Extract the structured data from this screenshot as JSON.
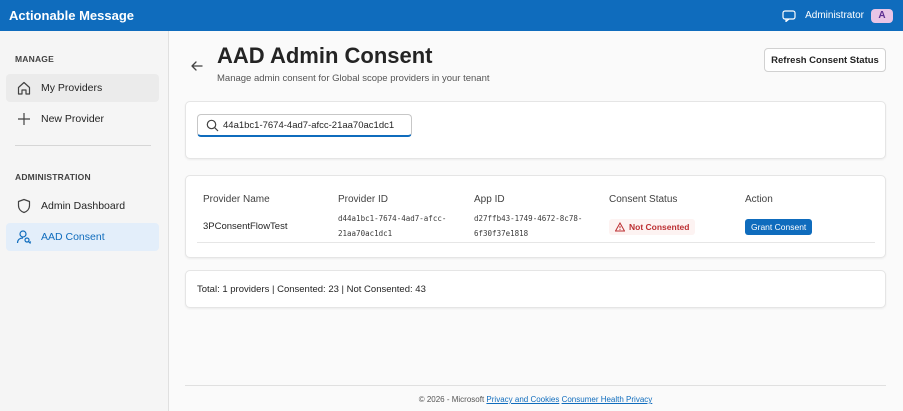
{
  "app": {
    "title": "Actionable Message"
  },
  "user": {
    "name": "Administrator",
    "initial": "A"
  },
  "sidebar": {
    "manage_header": "MANAGE",
    "admin_header": "ADMINISTRATION",
    "items": [
      {
        "label": "My Providers",
        "icon": "home-icon"
      },
      {
        "label": "New Provider",
        "icon": "plus-icon"
      },
      {
        "label": "Admin Dashboard",
        "icon": "shield-icon"
      },
      {
        "label": "AAD Consent",
        "icon": "person-key-icon"
      }
    ]
  },
  "page": {
    "title": "AAD Admin Consent",
    "subtitle": "Manage admin consent for Global scope providers in your tenant",
    "refresh_label": "Refresh Consent Status"
  },
  "search": {
    "value": "44a1bc1-7674-4ad7-afcc-21aa70ac1dc1"
  },
  "table": {
    "headers": [
      "Provider Name",
      "Provider ID",
      "App ID",
      "Consent Status",
      "Action"
    ],
    "rows": [
      {
        "provider_name": "3PConsentFlowTest",
        "provider_id_line1": "d44a1bc1-7674-4ad7-afcc-",
        "provider_id_line2": "21aa70ac1dc1",
        "app_id_line1": "d27ffb43-1749-4672-8c78-",
        "app_id_line2": "6f30f37e1818",
        "status": "Not Consented",
        "action": "Grant Consent"
      }
    ]
  },
  "summary": {
    "text": "Total: 1 providers | Consented: 23 | Not Consented: 43"
  },
  "footer": {
    "copyright": "© 2026 - Microsoft",
    "privacy_link": "Privacy and Cookies",
    "health_link": "Consumer Health Privacy"
  },
  "colors": {
    "brand": "#0f6cbd",
    "error": "#bc2f32"
  }
}
